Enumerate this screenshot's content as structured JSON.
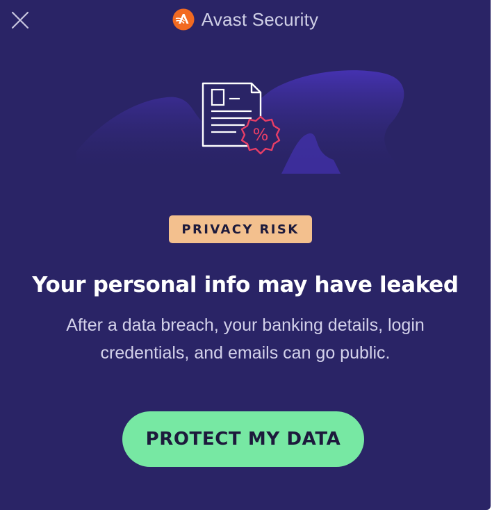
{
  "header": {
    "close_icon": "close-icon",
    "brand_icon": "avast-logo-icon",
    "brand_name": "Avast Security"
  },
  "illustration": {
    "icon": "document-discount-icon",
    "badge_symbol": "%"
  },
  "badge": {
    "label": "PRIVACY RISK"
  },
  "headline": "Your personal info may have leaked",
  "subtext": {
    "line1": "After a data breach, your banking details, login",
    "line2": "credentials, and emails can go public."
  },
  "cta": {
    "label": "PROTECT MY DATA"
  },
  "colors": {
    "background": "#2a2466",
    "badge": "#f3c08e",
    "cta": "#77e8a3",
    "accent": "#e83e66",
    "brand_orange": "#f26a21"
  }
}
